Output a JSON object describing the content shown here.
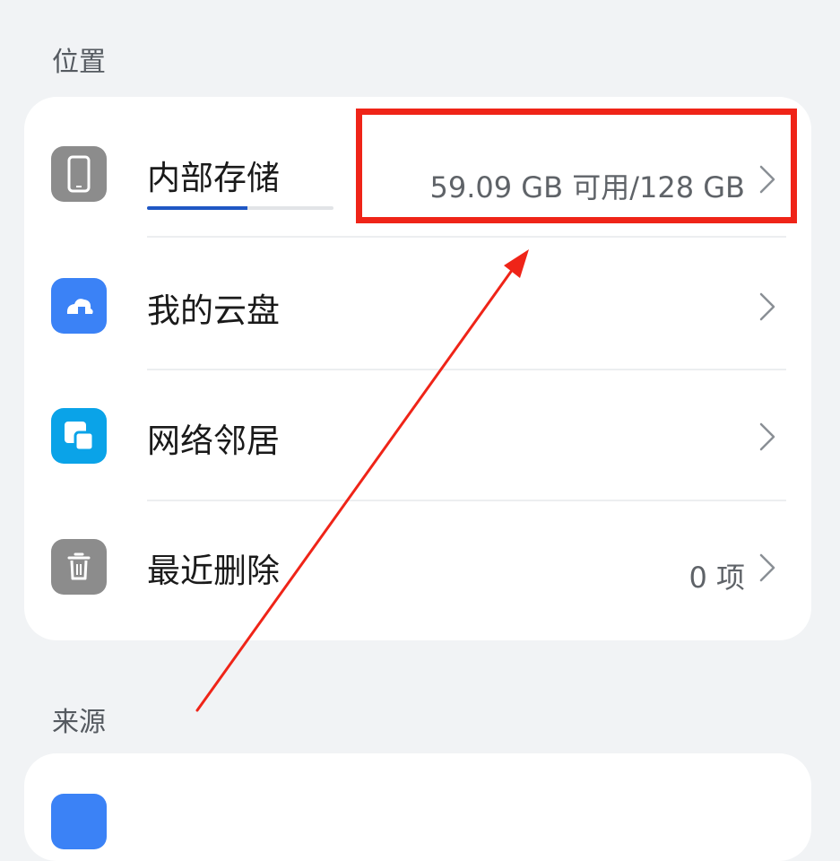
{
  "sections": {
    "location": {
      "header": "位置",
      "items": [
        {
          "label": "内部存储",
          "value": "59.09 GB 可用/128 GB",
          "icon": "phone-icon",
          "used_fraction": 0.54
        },
        {
          "label": "我的云盘",
          "value": "",
          "icon": "cloud-drive-icon"
        },
        {
          "label": "网络邻居",
          "value": "",
          "icon": "network-neighbor-icon"
        },
        {
          "label": "最近删除",
          "value": "0 项",
          "icon": "trash-icon"
        }
      ]
    },
    "source": {
      "header": "来源"
    }
  },
  "colors": {
    "background": "#f1f3f5",
    "card": "#ffffff",
    "accent_blue": "#1f57c4",
    "icon_gray": "#8c8c8c",
    "icon_blue": "#3b82f6",
    "icon_cyan": "#0aa3e8",
    "annotation_red": "#ef2418"
  }
}
